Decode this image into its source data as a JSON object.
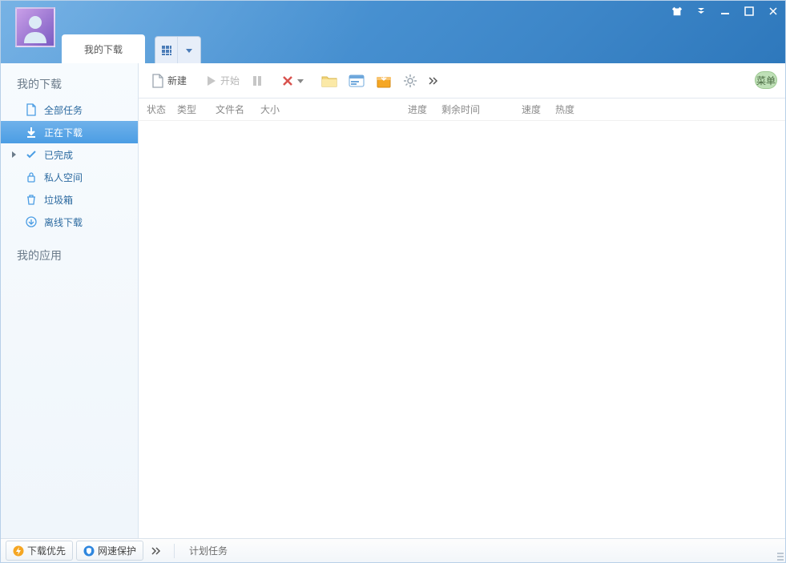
{
  "window": {
    "tab_label": "我的下载"
  },
  "sidebar": {
    "group1_title": "我的下载",
    "group2_title": "我的应用",
    "items": [
      {
        "label": "全部任务"
      },
      {
        "label": "正在下载"
      },
      {
        "label": "已完成"
      },
      {
        "label": "私人空间"
      },
      {
        "label": "垃圾箱"
      },
      {
        "label": "离线下载"
      }
    ]
  },
  "toolbar": {
    "new_label": "新建",
    "start_label": "开始",
    "menu_label": "菜单"
  },
  "columns": {
    "c0": "状态",
    "c1": "类型",
    "c2": "文件名",
    "c3": "大小",
    "c4": "进度",
    "c5": "剩余时间",
    "c6": "速度",
    "c7": "热度"
  },
  "statusbar": {
    "priority_label": "下载优先",
    "speed_protect_label": "网速保护",
    "plan_label": "计划任务"
  }
}
